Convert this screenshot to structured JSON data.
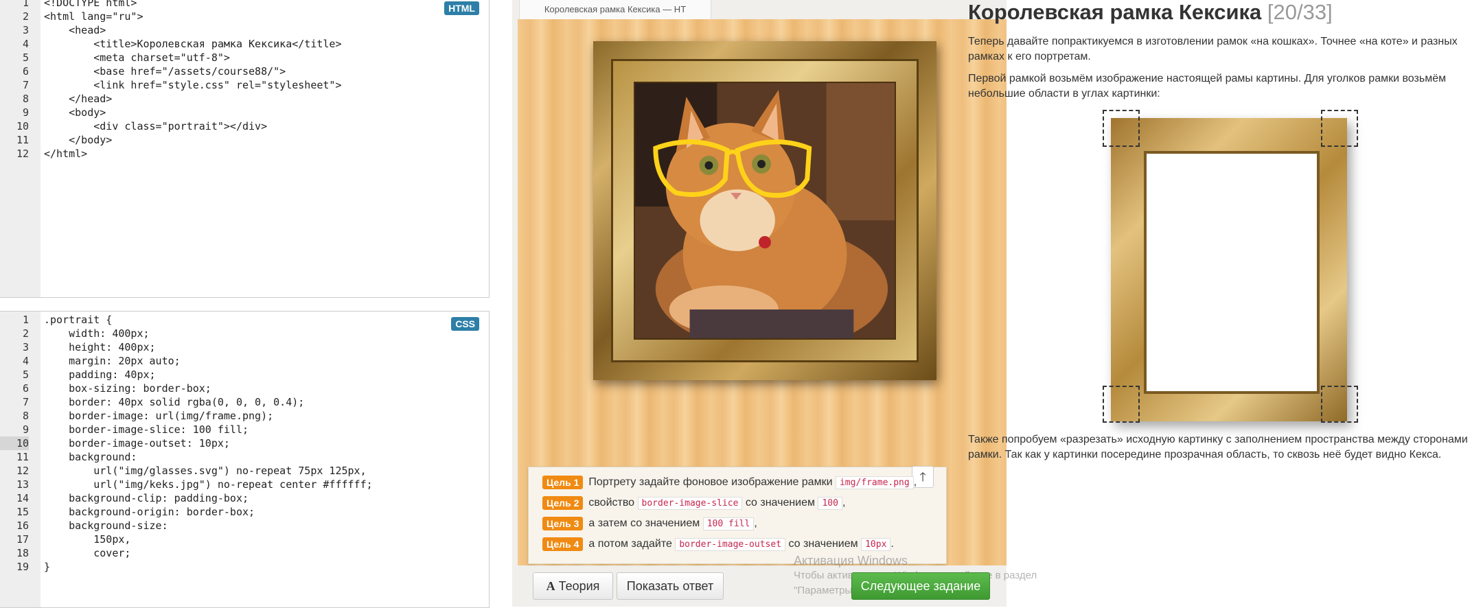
{
  "html_editor": {
    "badge": "HTML",
    "lines": [
      {
        "n": "1",
        "t": "<!DOCTYPE html>"
      },
      {
        "n": "2",
        "t": "<html lang=\"ru\">"
      },
      {
        "n": "3",
        "t": "    <head>"
      },
      {
        "n": "4",
        "t": "        <title>Королевская рамка Кексика</title>"
      },
      {
        "n": "5",
        "t": "        <meta charset=\"utf-8\">"
      },
      {
        "n": "6",
        "t": "        <base href=\"/assets/course88/\">"
      },
      {
        "n": "7",
        "t": "        <link href=\"style.css\" rel=\"stylesheet\">"
      },
      {
        "n": "8",
        "t": "    </head>"
      },
      {
        "n": "9",
        "t": "    <body>"
      },
      {
        "n": "10",
        "t": "        <div class=\"portrait\"></div>"
      },
      {
        "n": "11",
        "t": "    </body>"
      },
      {
        "n": "12",
        "t": "</html>"
      }
    ]
  },
  "css_editor": {
    "badge": "CSS",
    "active_line": "10",
    "lines": [
      {
        "n": "1",
        "t": ".portrait {"
      },
      {
        "n": "2",
        "t": "    width: 400px;"
      },
      {
        "n": "3",
        "t": "    height: 400px;"
      },
      {
        "n": "4",
        "t": "    margin: 20px auto;"
      },
      {
        "n": "5",
        "t": "    padding: 40px;"
      },
      {
        "n": "6",
        "t": "    box-sizing: border-box;"
      },
      {
        "n": "7",
        "t": "    border: 40px solid rgba(0, 0, 0, 0.4);"
      },
      {
        "n": "8",
        "t": "    border-image: url(img/frame.png);"
      },
      {
        "n": "9",
        "t": "    border-image-slice: 100 fill;"
      },
      {
        "n": "10",
        "t": "    border-image-outset: 10px;"
      },
      {
        "n": "11",
        "t": "    background:"
      },
      {
        "n": "12",
        "t": "        url(\"img/glasses.svg\") no-repeat 75px 125px,"
      },
      {
        "n": "13",
        "t": "        url(\"img/keks.jpg\") no-repeat center #ffffff;"
      },
      {
        "n": "14",
        "t": "    background-clip: padding-box;"
      },
      {
        "n": "15",
        "t": "    background-origin: border-box;"
      },
      {
        "n": "16",
        "t": "    background-size:"
      },
      {
        "n": "17",
        "t": "        150px,"
      },
      {
        "n": "18",
        "t": "        cover;"
      },
      {
        "n": "19",
        "t": "}"
      }
    ]
  },
  "preview": {
    "tab_title": "Королевская рамка Кексика — HT",
    "tasks": [
      {
        "tag": "Цель 1",
        "before": "Портрету задайте фоновое изображение рамки",
        "code": "img/frame.png",
        "after": ","
      },
      {
        "tag": "Цель 2",
        "before": "свойство",
        "code": "border-image-slice",
        "after": "со значением",
        "code2": "100",
        "after2": ","
      },
      {
        "tag": "Цель 3",
        "before": "а затем со значением",
        "code": "100 fill",
        "after": ","
      },
      {
        "tag": "Цель 4",
        "before": "а потом задайте",
        "code": "border-image-outset",
        "after": "со значением",
        "code2": "10px",
        "after2": "."
      }
    ],
    "up_arrow": "🡑",
    "buttons": {
      "theory": "Теория",
      "theory_icon": "A",
      "show_answer": "Показать ответ",
      "next": "Следующее задание"
    },
    "watermark": {
      "line1": "Активация Windows",
      "line2": "Чтобы активировать Windows, перейдите в раздел",
      "line3": "\"Параметры\"."
    }
  },
  "theory": {
    "title": "Королевская рамка Кексика",
    "progress": "[20/33]",
    "p1": "Теперь давайте попрактикуемся в изготовлении рамок «на кошках». Точнее «на коте» и разных рамках к его портретам.",
    "p2": "Первой рамкой возьмём изображение настоящей рамы картины. Для уголков рамки возьмём небольшие области в углах картинки:",
    "p3": "Также попробуем «разрезать» исходную картинку с заполнением пространства между сторонами рамки. Так как у картинки посередине прозрачная область, то сквозь неё будет видно Кекса."
  },
  "colors": {
    "badge": "#2d7fa7",
    "goal_tag": "#f08a12",
    "next_button": "#4caf3f",
    "code_text": "#c7254e"
  }
}
